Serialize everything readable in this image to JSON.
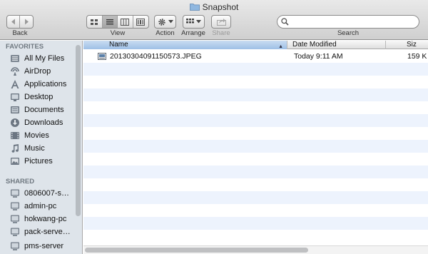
{
  "window": {
    "title": "Snapshot"
  },
  "toolbar": {
    "back_label": "Back",
    "view_label": "View",
    "action_label": "Action",
    "arrange_label": "Arrange",
    "share_label": "Share",
    "search_label": "Search",
    "search_placeholder": ""
  },
  "sidebar": {
    "favorites_heading": "FAVORITES",
    "favorites": [
      {
        "label": "All My Files",
        "icon": "all-files-icon"
      },
      {
        "label": "AirDrop",
        "icon": "airdrop-icon"
      },
      {
        "label": "Applications",
        "icon": "applications-icon"
      },
      {
        "label": "Desktop",
        "icon": "desktop-icon"
      },
      {
        "label": "Documents",
        "icon": "documents-icon"
      },
      {
        "label": "Downloads",
        "icon": "downloads-icon"
      },
      {
        "label": "Movies",
        "icon": "movies-icon"
      },
      {
        "label": "Music",
        "icon": "music-icon"
      },
      {
        "label": "Pictures",
        "icon": "pictures-icon"
      }
    ],
    "shared_heading": "SHARED",
    "shared": [
      {
        "label": "0806007-s…",
        "icon": "computer-icon"
      },
      {
        "label": "admin-pc",
        "icon": "computer-icon"
      },
      {
        "label": "hokwang-pc",
        "icon": "computer-icon"
      },
      {
        "label": "pack-serve…",
        "icon": "computer-icon"
      },
      {
        "label": "pms-server",
        "icon": "computer-icon"
      }
    ]
  },
  "file_list": {
    "columns": {
      "name": "Name",
      "date_modified": "Date Modified",
      "size": "Siz"
    },
    "files": [
      {
        "name": "20130304091150573.JPEG",
        "date_modified": "Today 9:11 AM",
        "size": "159 K"
      }
    ]
  },
  "colors": {
    "selected_column": "#a9c7ec",
    "row_stripe": "#edf3fd",
    "sidebar_bg": "#dee4ea"
  }
}
